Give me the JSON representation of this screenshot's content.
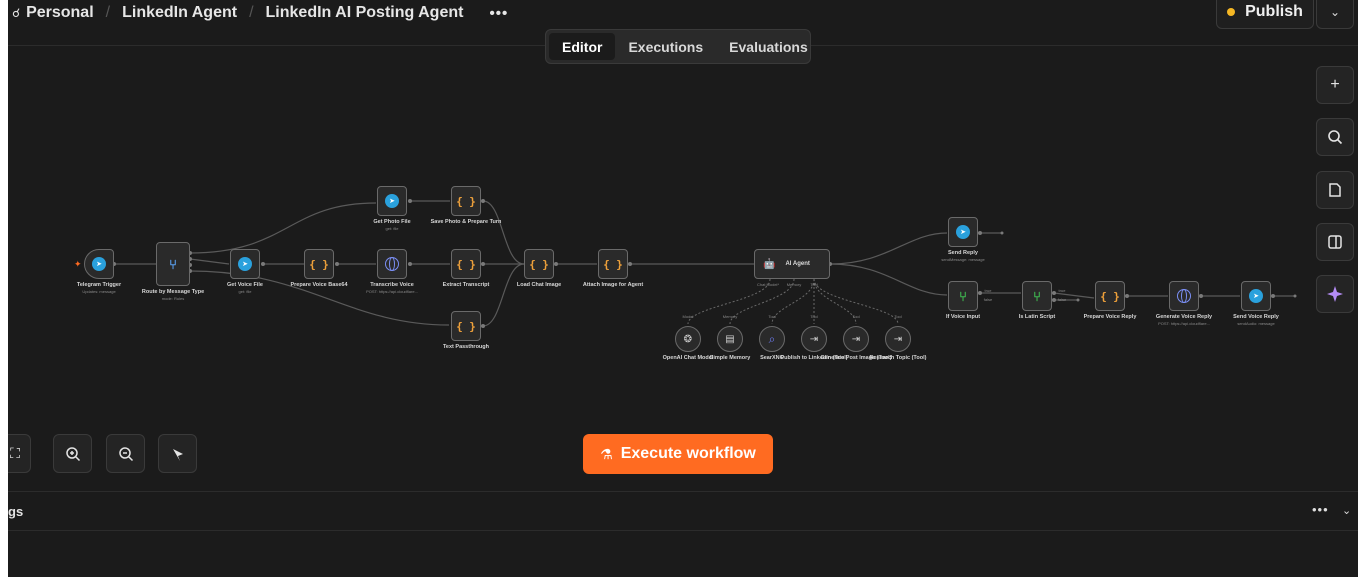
{
  "header": {
    "breadcrumbs": [
      "Personal",
      "LinkedIn Agent",
      "LinkedIn AI Posting Agent"
    ],
    "more_label": "•••",
    "publish_label": "Publish",
    "publish_dot_color": "#f5b724",
    "chevron": "⌄"
  },
  "tabs": [
    {
      "label": "Editor",
      "active": true
    },
    {
      "label": "Executions",
      "active": false
    },
    {
      "label": "Evaluations",
      "active": false
    }
  ],
  "nodes": {
    "telegram_trigger": {
      "label": "Telegram Trigger",
      "sub": "Updates: message",
      "icon": "telegram-icon"
    },
    "route": {
      "label": "Route by Message Type",
      "sub": "mode: Rules",
      "icon": "route-icon"
    },
    "get_voice": {
      "label": "Get Voice File",
      "sub": "get: file",
      "icon": "telegram-icon"
    },
    "prepare_voice": {
      "label": "Prepare Voice Base64",
      "icon": "code-icon"
    },
    "transcribe": {
      "label": "Transcribe Voice",
      "sub": "POST: https://api.cloudflare...",
      "icon": "globe-icon"
    },
    "get_photo": {
      "label": "Get Photo File",
      "sub": "get: file",
      "icon": "telegram-icon"
    },
    "save_photo": {
      "label": "Save Photo & Prepare Turn",
      "icon": "code-icon"
    },
    "extract": {
      "label": "Extract Transcript",
      "icon": "code-icon"
    },
    "text_pass": {
      "label": "Text Passthrough",
      "icon": "code-icon"
    },
    "load_chat": {
      "label": "Load Chat Image",
      "icon": "code-icon"
    },
    "attach_image": {
      "label": "Attach Image for Agent",
      "icon": "code-icon"
    },
    "ai_agent": {
      "label": "AI Agent",
      "slots": [
        "Chat Model*",
        "Memory",
        "Tool"
      ]
    },
    "send_reply": {
      "label": "Send Reply",
      "sub": "sendMessage: message",
      "icon": "telegram-icon"
    },
    "if_voice": {
      "label": "If Voice Input",
      "icon": "if-icon",
      "out_true": "true",
      "out_false": "false"
    },
    "is_latin": {
      "label": "Is Latin Script",
      "icon": "if-icon",
      "out_true": "true",
      "out_false": "false"
    },
    "prepare_reply": {
      "label": "Prepare Voice Reply",
      "icon": "code-icon"
    },
    "gen_voice": {
      "label": "Generate Voice Reply",
      "sub": "POST: https://api.cloudflare...",
      "icon": "globe-icon"
    },
    "send_voice": {
      "label": "Send Voice Reply",
      "sub": "sendAudio: message",
      "icon": "telegram-icon"
    }
  },
  "tools": [
    {
      "slot": "Model",
      "label": "OpenAI Chat Model",
      "icon": "openai-icon"
    },
    {
      "slot": "Memory",
      "label": "Simple Memory",
      "icon": "memory-icon"
    },
    {
      "slot": "Tool",
      "label": "SearXNG",
      "icon": "search-icon"
    },
    {
      "slot": "Tool",
      "label": "Publish to LinkedIn (Tool)",
      "icon": "tool-icon"
    },
    {
      "slot": "Tool",
      "label": "Generate Post Image (Tool)",
      "icon": "tool-icon"
    },
    {
      "slot": "Tool",
      "label": "Research Topic (Tool)",
      "icon": "tool-icon"
    }
  ],
  "canvas_controls": {
    "fit_icon": "fit-view-icon",
    "zoom_in_icon": "zoom-in-icon",
    "zoom_out_icon": "zoom-out-icon",
    "tidy_icon": "tidy-up-icon"
  },
  "side_controls": [
    "add-node-icon",
    "search-icon",
    "sticky-note-icon",
    "panel-icon",
    "ai-sparkle-icon"
  ],
  "execute_label": "Execute workflow",
  "accent_color": "#ff6b21",
  "logs": {
    "title": "gs",
    "more_label": "•••",
    "chevron": "⌄"
  }
}
